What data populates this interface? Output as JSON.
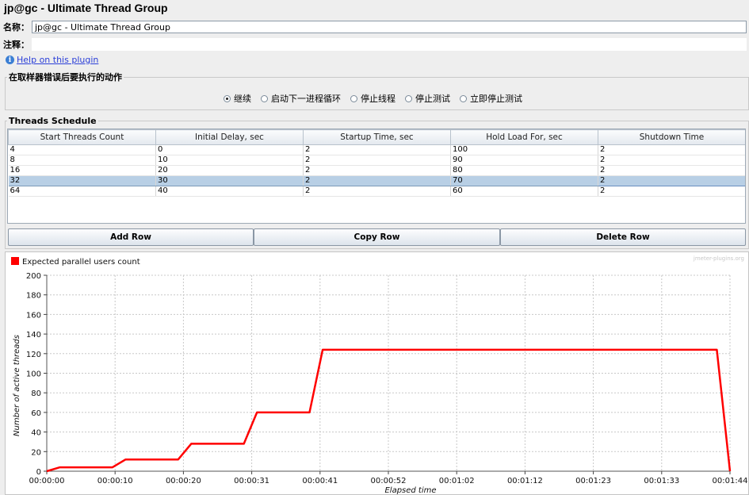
{
  "window_title": "jp@gc - Ultimate Thread Group",
  "name_label": "名称：",
  "name_value": "jp@gc - Ultimate Thread Group",
  "comment_label": "注释：",
  "comment_value": "",
  "help_link": "Help on this plugin",
  "error_action": {
    "legend": "在取样器错误后要执行的动作",
    "options": [
      "继续",
      "启动下一进程循环",
      "停止线程",
      "停止测试",
      "立即停止测试"
    ],
    "selected": "继续"
  },
  "threads_schedule": {
    "legend": "Threads Schedule",
    "columns": [
      "Start Threads Count",
      "Initial Delay, sec",
      "Startup Time, sec",
      "Hold Load For, sec",
      "Shutdown Time"
    ],
    "rows": [
      [
        "4",
        "0",
        "2",
        "100",
        "2"
      ],
      [
        "8",
        "10",
        "2",
        "90",
        "2"
      ],
      [
        "16",
        "20",
        "2",
        "80",
        "2"
      ],
      [
        "32",
        "30",
        "2",
        "70",
        "2"
      ],
      [
        "64",
        "40",
        "2",
        "60",
        "2"
      ]
    ],
    "selected_row": 3
  },
  "buttons": {
    "add_row": "Add Row",
    "copy_row": "Copy Row",
    "delete_row": "Delete Row"
  },
  "chart_watermark": "jmeter-plugins.org",
  "chart_data": {
    "type": "line",
    "series": [
      {
        "name": "Expected parallel users count",
        "color": "#ff0000",
        "x": [
          0,
          2,
          10,
          12,
          20,
          22,
          30,
          32,
          40,
          42,
          102,
          104
        ],
        "y": [
          0,
          4,
          4,
          12,
          12,
          28,
          28,
          60,
          60,
          124,
          124,
          0
        ]
      }
    ],
    "xlabel": "Elapsed time",
    "ylabel": "Number of active threads",
    "xlim": [
      0,
      104
    ],
    "ylim": [
      0,
      200
    ],
    "yticks": [
      0,
      20,
      40,
      60,
      80,
      100,
      120,
      140,
      160,
      180,
      200
    ],
    "xticks": [
      0,
      10.4,
      20.8,
      31.2,
      41.6,
      52,
      62.4,
      72.8,
      83.2,
      93.6,
      104
    ],
    "xtick_labels": [
      "00:00:00",
      "00:00:10",
      "00:00:20",
      "00:00:31",
      "00:00:41",
      "00:00:52",
      "00:01:02",
      "00:01:12",
      "00:01:23",
      "00:01:33",
      "00:01:44"
    ],
    "grid": true,
    "legend_position": "top-left"
  }
}
